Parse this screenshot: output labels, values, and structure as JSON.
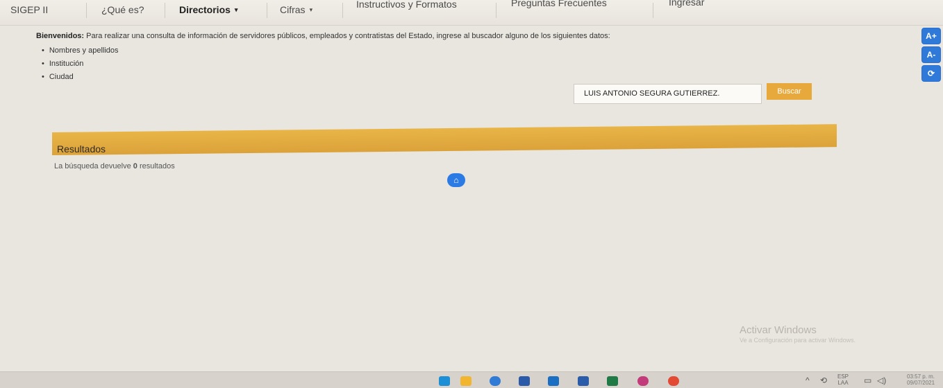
{
  "nav": {
    "items": [
      {
        "label": "SIGEP II",
        "active": false
      },
      {
        "label": "¿Qué es?",
        "active": false
      },
      {
        "label": "Directorios",
        "active": true,
        "caret": "▾"
      },
      {
        "label": "Cifras",
        "active": false,
        "caret": "▾"
      },
      {
        "label": "Instructivos y Formatos",
        "active": false
      },
      {
        "label": "Preguntas Frecuentes",
        "active": false
      },
      {
        "label": "Ingresar",
        "active": false
      }
    ]
  },
  "welcome": {
    "lead": "Bienvenidos:",
    "text": " Para realizar una consulta de información de servidores públicos, empleados y contratistas del Estado, ingrese al buscador alguno de los siguientes datos:",
    "items": [
      "Nombres y apellidos",
      "Institución",
      "Ciudad"
    ]
  },
  "search": {
    "value": "LUIS ANTONIO SEGURA GUTIERREZ.",
    "button_label": "Buscar"
  },
  "results": {
    "title": "Resultados",
    "prefix": "La búsqueda devuelve ",
    "count": "0",
    "suffix": " resultados"
  },
  "side_tools": [
    "A+",
    "A-",
    "⟳"
  ],
  "home_icon": "home-icon",
  "watermark": {
    "title": "Activar Windows",
    "subtitle": "Ve a Configuración para activar Windows."
  },
  "taskbar": {
    "lang_top": "ESP",
    "lang_bottom": "LAA",
    "time": "03:57 p. m.",
    "date": "09/07/2021",
    "icons": [
      {
        "name": "edge-icon",
        "color": "#1d8fd6"
      },
      {
        "name": "file-explorer-icon",
        "color": "#f2b530"
      },
      {
        "name": "store-icon",
        "color": "#2f7bd6"
      },
      {
        "name": "app-icon",
        "color": "#2b5aa8"
      },
      {
        "name": "outlook-icon",
        "color": "#1b6fc2"
      },
      {
        "name": "word-icon",
        "color": "#2a5caa"
      },
      {
        "name": "excel-icon",
        "color": "#1f7a45"
      },
      {
        "name": "app-colorful-icon",
        "color": "#c23b7a"
      },
      {
        "name": "chrome-icon",
        "color": "#e24a33"
      }
    ]
  }
}
